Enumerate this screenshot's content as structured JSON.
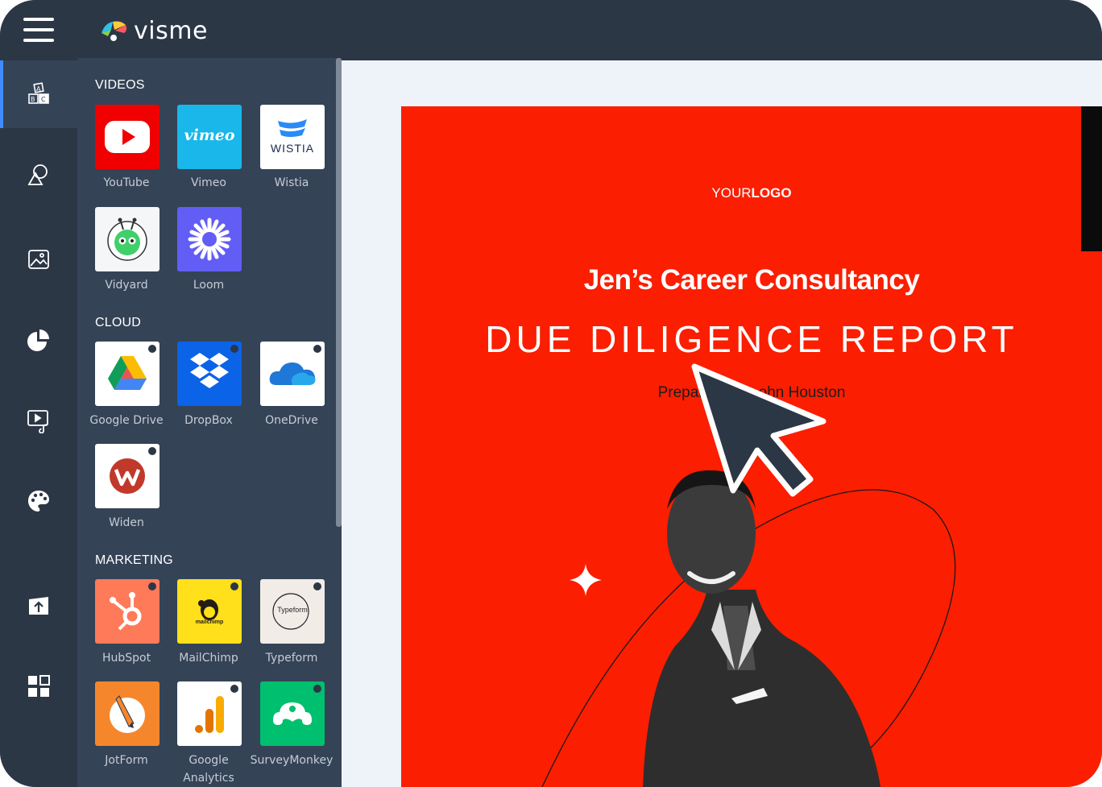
{
  "app": {
    "logo_text": "visme"
  },
  "rail": {
    "items": [
      {
        "icon": "blocks-icon",
        "active": true
      },
      {
        "icon": "shapes-icon",
        "active": false
      },
      {
        "icon": "image-icon",
        "active": false
      },
      {
        "icon": "chart-icon",
        "active": false
      },
      {
        "icon": "media-icon",
        "active": false
      },
      {
        "icon": "palette-icon",
        "active": false
      },
      {
        "icon": "upload-icon",
        "active": false
      },
      {
        "icon": "apps-icon",
        "active": false
      }
    ]
  },
  "panel": {
    "sections": [
      {
        "title": "VIDEOS"
      },
      {
        "title": "CLOUD"
      },
      {
        "title": "MARKETING"
      }
    ],
    "tiles": {
      "youtube": "YouTube",
      "vimeo": "Vimeo",
      "vimeo_logo": "vimeo",
      "wistia": "Wistia",
      "wistia_logo": "WISTIA",
      "vidyard": "Vidyard",
      "loom": "Loom",
      "google_drive": "Google Drive",
      "dropbox": "DropBox",
      "onedrive": "OneDrive",
      "widen": "Widen",
      "hubspot": "HubSpot",
      "mailchimp": "MailChimp",
      "mailchimp_logo": "mailchimp",
      "typeform": "Typeform",
      "typeform_logo": "Typeform",
      "jotform": "JotForm",
      "google_analytics_1": "Google",
      "google_analytics_2": "Analytics",
      "surveymonkey": "SurveyMonkey"
    }
  },
  "slide": {
    "logo_regular": "YOUR",
    "logo_bold": "LOGO",
    "company": "Jen’s Career Consultancy",
    "report_title": "DUE DILIGENCE REPORT",
    "prepared_left": "Prepar",
    "prepared_right": "ohn Houston"
  },
  "colors": {
    "chrome": "#2c3746",
    "panel": "#354357",
    "slide_bg": "#fb1e00",
    "canvas_bg": "#eef3fa"
  }
}
